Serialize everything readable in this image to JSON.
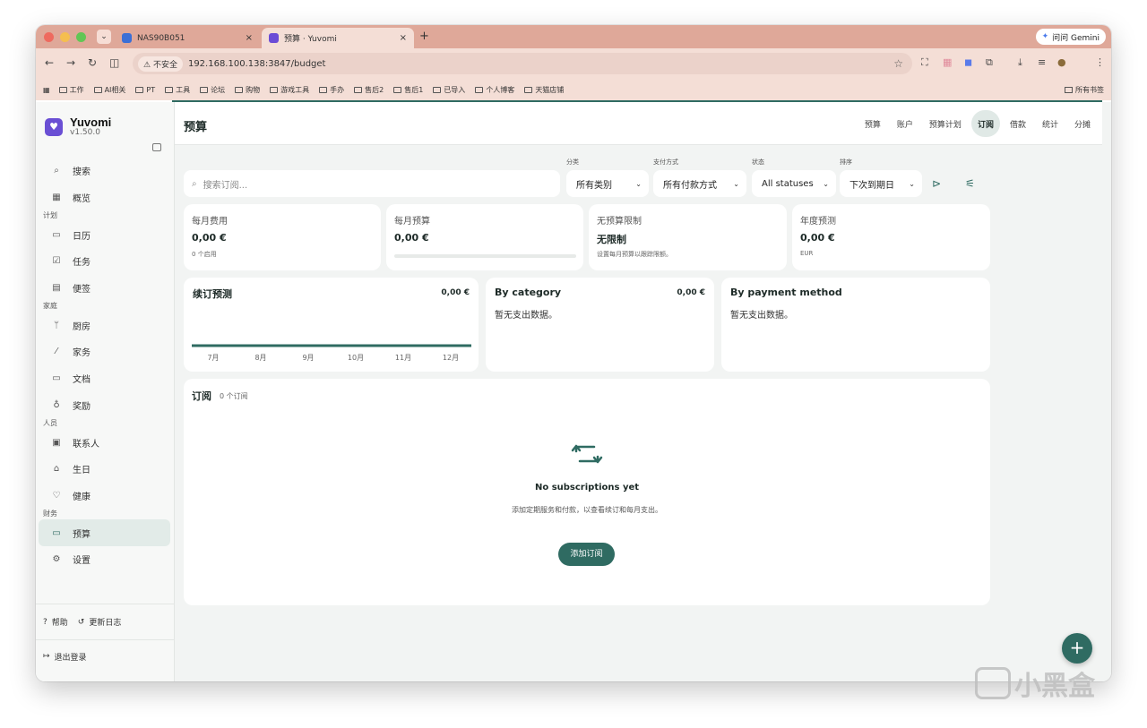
{
  "browser": {
    "tabs": [
      {
        "title": "NAS90B051"
      },
      {
        "title": "预算 · Yuvomi"
      }
    ],
    "gemini_label": "问问 Gemini",
    "security_label": "不安全",
    "url": "192.168.100.138:3847/budget",
    "bookmarks": [
      "工作",
      "AI相关",
      "PT",
      "工具",
      "论坛",
      "购物",
      "游戏工具",
      "手办",
      "售后2",
      "售后1",
      "已导入",
      "个人博客",
      "天猫店铺"
    ],
    "all_bookmarks": "所有书签"
  },
  "brand": {
    "name": "Yuvomi",
    "version": "v1.50.0"
  },
  "sidebar": {
    "items": [
      {
        "type": "item",
        "label": "搜索",
        "icon": "search-icon",
        "glyph": "⌕"
      },
      {
        "type": "item",
        "label": "概览",
        "icon": "grid-icon",
        "glyph": "▦"
      },
      {
        "type": "section",
        "label": "计划"
      },
      {
        "type": "item",
        "label": "日历",
        "icon": "calendar-icon",
        "glyph": "▭"
      },
      {
        "type": "item",
        "label": "任务",
        "icon": "check-square-icon",
        "glyph": "☑"
      },
      {
        "type": "item",
        "label": "便签",
        "icon": "note-icon",
        "glyph": "▤"
      },
      {
        "type": "section",
        "label": "家庭"
      },
      {
        "type": "item",
        "label": "厨房",
        "icon": "utensils-icon",
        "glyph": "ᛘ"
      },
      {
        "type": "item",
        "label": "家务",
        "icon": "brush-icon",
        "glyph": "⁄"
      },
      {
        "type": "item",
        "label": "文档",
        "icon": "folder-icon",
        "glyph": "▭"
      },
      {
        "type": "item",
        "label": "奖励",
        "icon": "medal-icon",
        "glyph": "♁"
      },
      {
        "type": "section",
        "label": "人员"
      },
      {
        "type": "item",
        "label": "联系人",
        "icon": "contact-icon",
        "glyph": "▣"
      },
      {
        "type": "item",
        "label": "生日",
        "icon": "cake-icon",
        "glyph": "⌂"
      },
      {
        "type": "item",
        "label": "健康",
        "icon": "heart-pulse-icon",
        "glyph": "♡"
      },
      {
        "type": "section",
        "label": "财务"
      },
      {
        "type": "item",
        "label": "预算",
        "icon": "wallet-icon",
        "glyph": "▭",
        "active": true
      },
      {
        "type": "item",
        "label": "设置",
        "icon": "gear-icon",
        "glyph": "⚙"
      }
    ],
    "help": "帮助",
    "changelog": "更新日志",
    "logout": "退出登录"
  },
  "header": {
    "title": "预算",
    "tabs": [
      {
        "label": "预算"
      },
      {
        "label": "账户"
      },
      {
        "label": "预算计划"
      },
      {
        "label": "订阅",
        "active": true
      },
      {
        "label": "借款"
      },
      {
        "label": "统计"
      },
      {
        "label": "分摊"
      }
    ]
  },
  "filters": {
    "search_placeholder": "搜索订阅...",
    "category_label": "分类",
    "category_value": "所有类别",
    "payment_label": "支付方式",
    "payment_value": "所有付款方式",
    "status_label": "状态",
    "status_value": "All statuses",
    "sort_label": "排序",
    "sort_value": "下次到期日"
  },
  "stats": [
    {
      "label": "每月费用",
      "value": "0,00 €",
      "sub": "0 个启用"
    },
    {
      "label": "每月预算",
      "value": "0,00 €",
      "progress": 0
    },
    {
      "label": "无预算限制",
      "value": "无限制",
      "sub": "设置每月预算以跟踪限额。"
    },
    {
      "label": "年度预测",
      "value": "0,00 €",
      "sub": "EUR"
    }
  ],
  "renewal": {
    "title": "续订预测",
    "value": "0,00 €",
    "months": [
      "7月",
      "8月",
      "9月",
      "10月",
      "11月",
      "12月"
    ]
  },
  "by_category": {
    "title": "By category",
    "value": "0,00 €",
    "empty": "暂无支出数据。"
  },
  "by_payment": {
    "title": "By payment method",
    "empty": "暂无支出数据。"
  },
  "subscriptions": {
    "title": "订阅",
    "count": "0 个订阅",
    "empty_title": "No subscriptions yet",
    "empty_desc": "添加定期服务和付款，以查看续订和每月支出。",
    "add_label": "添加订阅"
  },
  "colors": {
    "accent": "#2f6b62",
    "brand": "#6a4fd4",
    "chrome": "#dfa899"
  },
  "watermark": "小黑盒"
}
